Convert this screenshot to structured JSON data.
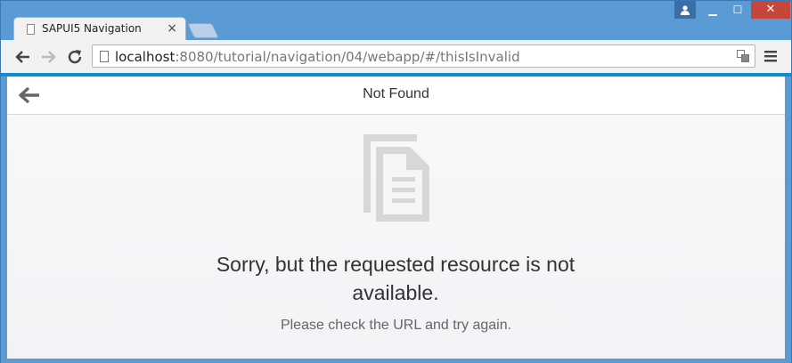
{
  "browser": {
    "tab": {
      "title": "SAPUI5 Navigation",
      "close_glyph": "×"
    },
    "window_controls": {
      "minimize": "▁",
      "maximize": "☐",
      "close": "✕"
    },
    "address": {
      "host": "localhost",
      "rest": ":8080/tutorial/navigation/04/webapp/#/thisIsInvalid"
    },
    "icons": [
      "back-arrow-icon",
      "forward-arrow-icon",
      "reload-icon",
      "page-icon",
      "translate-icon",
      "menu-icon",
      "profile-icon"
    ],
    "accent_color": "#0a8ed3",
    "frame_color": "#5a9bd5"
  },
  "app": {
    "header": {
      "title": "Not Found",
      "back_icon": "back-arrow-icon"
    },
    "message": {
      "icon": "document-icon",
      "title": "Sorry, but the requested resource is not available.",
      "description": "Please check the URL and try again."
    }
  }
}
